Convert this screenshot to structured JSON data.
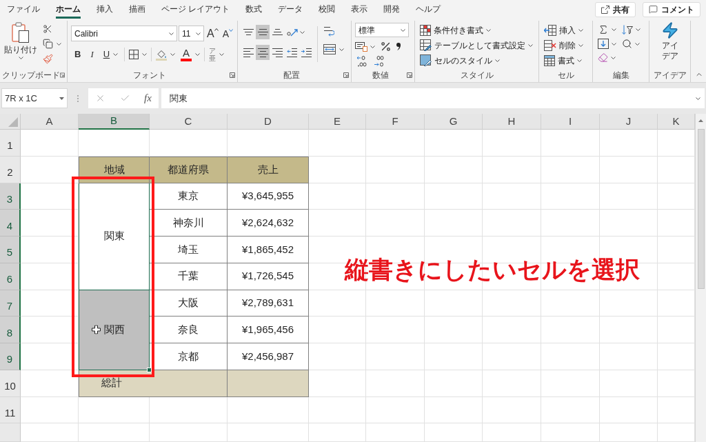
{
  "tabs": [
    {
      "label": "ファイル",
      "selected": false
    },
    {
      "label": "ホーム",
      "selected": true
    },
    {
      "label": "挿入",
      "selected": false
    },
    {
      "label": "描画",
      "selected": false
    },
    {
      "label": "ページ レイアウト",
      "selected": false
    },
    {
      "label": "数式",
      "selected": false
    },
    {
      "label": "データ",
      "selected": false
    },
    {
      "label": "校閲",
      "selected": false
    },
    {
      "label": "表示",
      "selected": false
    },
    {
      "label": "開発",
      "selected": false
    },
    {
      "label": "ヘルプ",
      "selected": false
    }
  ],
  "header_buttons": [
    {
      "kind": "share",
      "label": "共有"
    },
    {
      "kind": "comment",
      "label": "コメント"
    }
  ],
  "ribbon": {
    "clipboard": {
      "label": "クリップボード",
      "paste": "貼り付け"
    },
    "font": {
      "label": "フォント",
      "font_name": "Calibri",
      "font_size": "11",
      "grow": "A",
      "shrink": "A",
      "styles": [
        {
          "kind": "bold",
          "label": "B"
        },
        {
          "kind": "italic",
          "label": "I"
        },
        {
          "kind": "underline",
          "label": "U"
        }
      ],
      "font_color": "A",
      "phonetic": "ア亜"
    },
    "alignment": {
      "label": "配置",
      "vertical": [
        {
          "kind": "top",
          "selected": false
        },
        {
          "kind": "middle",
          "selected": true
        },
        {
          "kind": "bottom",
          "selected": false
        }
      ],
      "horizontal": [
        {
          "kind": "left",
          "selected": false
        },
        {
          "kind": "center",
          "selected": true
        },
        {
          "kind": "right",
          "selected": false
        }
      ]
    },
    "number": {
      "label": "数値",
      "format": "標準"
    },
    "styles": {
      "label": "スタイル",
      "items": [
        {
          "kind": "conditional",
          "label": "条件付き書式"
        },
        {
          "kind": "table",
          "label": "テーブルとして書式設定"
        },
        {
          "kind": "cell",
          "label": "セルのスタイル"
        }
      ]
    },
    "cells": {
      "label": "セル",
      "items": [
        {
          "kind": "insert",
          "label": "挿入"
        },
        {
          "kind": "delete",
          "label": "削除"
        },
        {
          "kind": "format",
          "label": "書式"
        }
      ]
    },
    "editing": {
      "label": "編集"
    },
    "ideas": {
      "label": "アイデア",
      "button": "アイデア"
    }
  },
  "formula_bar": {
    "name_box": "7R x 1C",
    "function_label": "fx",
    "content": "関東"
  },
  "sheet": {
    "columns": [
      {
        "label": "A",
        "selected": false
      },
      {
        "label": "B",
        "selected": true
      },
      {
        "label": "C",
        "selected": false
      },
      {
        "label": "D",
        "selected": false
      },
      {
        "label": "E",
        "selected": false
      },
      {
        "label": "F",
        "selected": false
      },
      {
        "label": "G",
        "selected": false
      },
      {
        "label": "H",
        "selected": false
      },
      {
        "label": "I",
        "selected": false
      },
      {
        "label": "J",
        "selected": false
      },
      {
        "label": "K",
        "selected": false
      }
    ],
    "rows": [
      {
        "label": "1",
        "selected": false
      },
      {
        "label": "2",
        "selected": false
      },
      {
        "label": "3",
        "selected": true
      },
      {
        "label": "4",
        "selected": true
      },
      {
        "label": "5",
        "selected": true
      },
      {
        "label": "6",
        "selected": true
      },
      {
        "label": "7",
        "selected": true
      },
      {
        "label": "8",
        "selected": true
      },
      {
        "label": "9",
        "selected": true
      },
      {
        "label": "10",
        "selected": false
      },
      {
        "label": "11",
        "selected": false
      }
    ]
  },
  "table": {
    "headers": [
      "地域",
      "都道府県",
      "売上"
    ],
    "groups": [
      {
        "region": "関東",
        "active": true,
        "rows": [
          {
            "prefecture": "東京",
            "sales": "¥3,645,955"
          },
          {
            "prefecture": "神奈川",
            "sales": "¥2,624,632"
          },
          {
            "prefecture": "埼玉",
            "sales": "¥1,865,452"
          },
          {
            "prefecture": "千葉",
            "sales": "¥1,726,545"
          }
        ]
      },
      {
        "region": "関西",
        "active": false,
        "rows": [
          {
            "prefecture": "大阪",
            "sales": "¥2,789,631"
          },
          {
            "prefecture": "奈良",
            "sales": "¥1,965,456"
          },
          {
            "prefecture": "京都",
            "sales": "¥2,456,987"
          }
        ]
      }
    ],
    "total": {
      "label": "総計"
    }
  },
  "annotation": "縦書きにしたいセルを選択"
}
